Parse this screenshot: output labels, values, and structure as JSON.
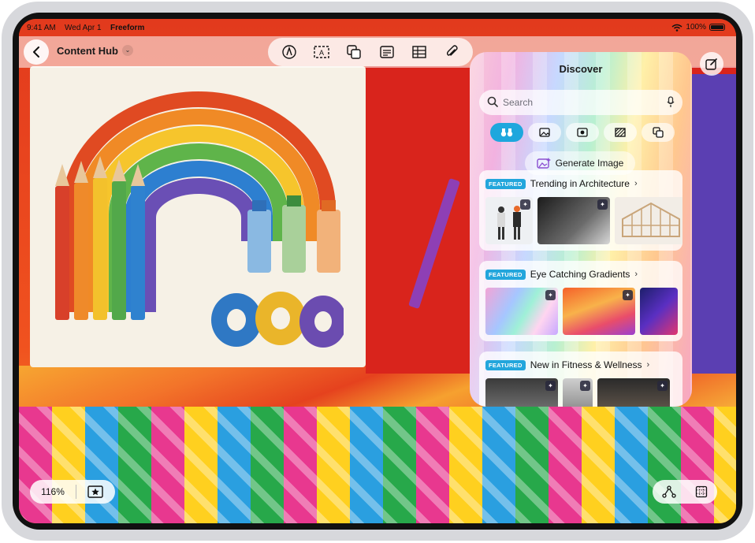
{
  "status_bar": {
    "time": "9:41 AM",
    "date": "Wed Apr 1",
    "app": "Freeform",
    "battery": "100%"
  },
  "toolbar": {
    "back_icon": "chevron-left-icon",
    "board_title": "Content Hub",
    "tools": [
      "pen-icon",
      "text-box-icon",
      "shapes-icon",
      "sticky-note-icon",
      "table-icon",
      "attachment-icon"
    ],
    "compose_icon": "compose-icon"
  },
  "discover": {
    "title": "Discover",
    "search_placeholder": "Search",
    "filters": [
      "binoculars-icon",
      "photo-icon",
      "sticker-icon",
      "pattern-icon",
      "shapes-icon"
    ],
    "generate_label": "Generate Image",
    "sections": [
      {
        "badge": "FEATURED",
        "title": "Trending in Architecture"
      },
      {
        "badge": "FEATURED",
        "title": "Eye Catching Gradients"
      },
      {
        "badge": "FEATURED",
        "title": "New in Fitness & Wellness"
      }
    ]
  },
  "bottom": {
    "zoom": "116%"
  },
  "colors": {
    "accent": "#1ea7dd",
    "canvas_red": "#d9241c"
  }
}
